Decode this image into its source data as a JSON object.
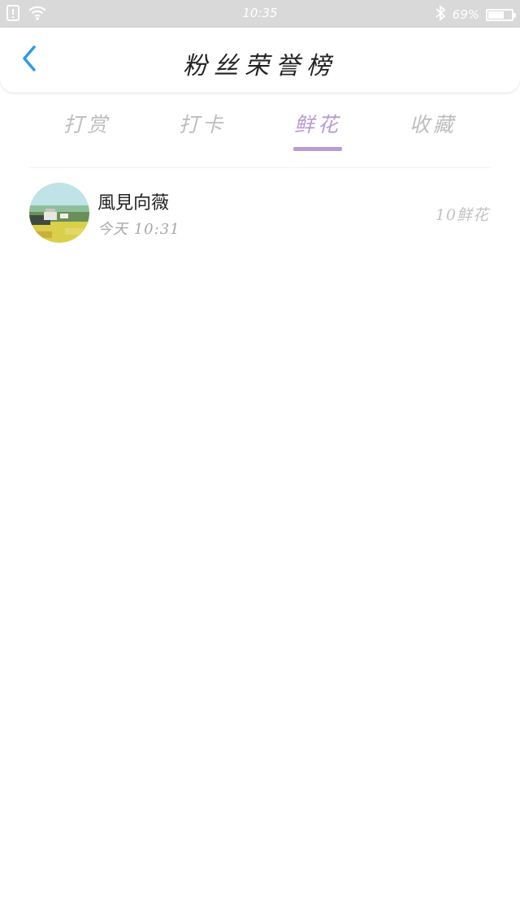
{
  "status_bar": {
    "time": "10:35",
    "battery_percent_label": "69%",
    "battery_level": 0.69
  },
  "header": {
    "title": "粉丝荣誉榜"
  },
  "tabs": [
    {
      "label": "打赏",
      "active": false
    },
    {
      "label": "打卡",
      "active": false
    },
    {
      "label": "鲜花",
      "active": true
    },
    {
      "label": "收藏",
      "active": false
    }
  ],
  "list": [
    {
      "name": "風見向薇",
      "time": "今天 10:31",
      "count": "10鲜花"
    }
  ],
  "colors": {
    "accent": "#b99ad3",
    "back_arrow": "#2f9be0",
    "status_bar_bg": "#d9d9d9"
  },
  "icons": {
    "back": "chevron-left-icon",
    "sim": "sim-alert-icon",
    "wifi": "wifi-icon",
    "bluetooth": "bluetooth-icon",
    "battery": "battery-icon"
  }
}
